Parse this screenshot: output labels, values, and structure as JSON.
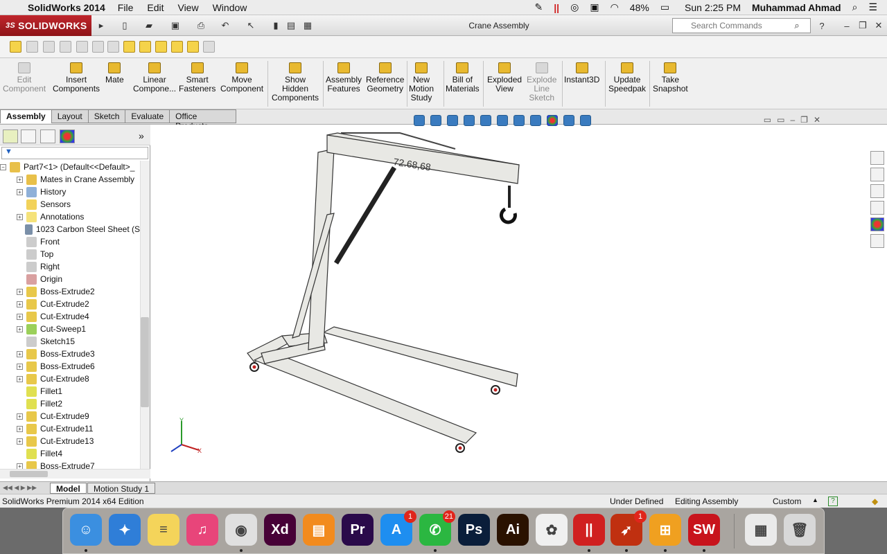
{
  "menubar": {
    "apple_icon": "apple-icon",
    "app_name": "SolidWorks 2014",
    "menus": [
      "File",
      "Edit",
      "View",
      "Window"
    ],
    "battery": "48%",
    "clock": "Sun 2:25 PM",
    "user": "Muhammad Ahmad"
  },
  "titlebar": {
    "brand": "SOLIDWORKS",
    "doc_title": "Crane Assembly",
    "search_placeholder": "Search Commands"
  },
  "commands": [
    {
      "label1": "Edit",
      "label2": "Component",
      "disabled": true
    },
    {
      "label1": "Insert",
      "label2": "Components"
    },
    {
      "label1": "Mate",
      "label2": ""
    },
    {
      "label1": "Linear",
      "label2": "Compone..."
    },
    {
      "label1": "Smart",
      "label2": "Fasteners"
    },
    {
      "label1": "Move",
      "label2": "Component"
    },
    {
      "label1": "Show",
      "label2": "Hidden",
      "label3": "Components"
    },
    {
      "label1": "Assembly",
      "label2": "Features"
    },
    {
      "label1": "Reference",
      "label2": "Geometry"
    },
    {
      "label1": "New",
      "label2": "Motion",
      "label3": "Study"
    },
    {
      "label1": "Bill of",
      "label2": "Materials"
    },
    {
      "label1": "Exploded",
      "label2": "View"
    },
    {
      "label1": "Explode",
      "label2": "Line",
      "label3": "Sketch",
      "disabled": true
    },
    {
      "label1": "Instant3D",
      "label2": ""
    },
    {
      "label1": "Update",
      "label2": "Speedpak"
    },
    {
      "label1": "Take",
      "label2": "Snapshot"
    }
  ],
  "tabs": [
    "Assembly",
    "Layout",
    "Sketch",
    "Evaluate",
    "Office Products"
  ],
  "tree": {
    "root": "Part7<1> (Default<<Default>_",
    "items": [
      {
        "label": "Mates in Crane Assembly",
        "exp": true,
        "color": "#e8c04a"
      },
      {
        "label": "History",
        "exp": true,
        "color": "#8fb0d8"
      },
      {
        "label": "Sensors",
        "exp": false,
        "color": "#f2d25a"
      },
      {
        "label": "Annotations",
        "exp": true,
        "color": "#f5e27a"
      },
      {
        "label": "1023 Carbon Steel Sheet (S",
        "exp": false,
        "color": "#7a8fa8"
      },
      {
        "label": "Front",
        "exp": false,
        "color": "#cccccc"
      },
      {
        "label": "Top",
        "exp": false,
        "color": "#cccccc"
      },
      {
        "label": "Right",
        "exp": false,
        "color": "#cccccc"
      },
      {
        "label": "Origin",
        "exp": false,
        "color": "#d9a0a0"
      },
      {
        "label": "Boss-Extrude2",
        "exp": true,
        "color": "#e8c84a"
      },
      {
        "label": "Cut-Extrude2",
        "exp": true,
        "color": "#e8c84a"
      },
      {
        "label": "Cut-Extrude4",
        "exp": true,
        "color": "#e8c84a"
      },
      {
        "label": "Cut-Sweep1",
        "exp": true,
        "color": "#9bd05a"
      },
      {
        "label": "Sketch15",
        "exp": false,
        "color": "#cccccc"
      },
      {
        "label": "Boss-Extrude3",
        "exp": true,
        "color": "#e8c84a"
      },
      {
        "label": "Boss-Extrude6",
        "exp": true,
        "color": "#e8c84a"
      },
      {
        "label": "Cut-Extrude8",
        "exp": true,
        "color": "#e8c84a"
      },
      {
        "label": "Fillet1",
        "exp": false,
        "color": "#e0e050"
      },
      {
        "label": "Fillet2",
        "exp": false,
        "color": "#e0e050"
      },
      {
        "label": "Cut-Extrude9",
        "exp": true,
        "color": "#e8c84a"
      },
      {
        "label": "Cut-Extrude11",
        "exp": true,
        "color": "#e8c84a"
      },
      {
        "label": "Cut-Extrude13",
        "exp": true,
        "color": "#e8c84a"
      },
      {
        "label": "Fillet4",
        "exp": false,
        "color": "#e0e050"
      },
      {
        "label": "Boss-Extrude7",
        "exp": true,
        "color": "#e8c84a"
      }
    ]
  },
  "viewport": {
    "dimension_label": "72.68,68",
    "axis_x": "X",
    "axis_y": "Y"
  },
  "bottom_tabs": [
    "Model",
    "Motion Study 1"
  ],
  "status": {
    "edition": "SolidWorks Premium 2014 x64 Edition",
    "state": "Under Defined",
    "mode": "Editing Assembly",
    "units": "Custom"
  },
  "dock": [
    {
      "name": "finder",
      "color": "#3b8fe0",
      "glyph": "☺"
    },
    {
      "name": "safari",
      "color": "#2f7ed8",
      "glyph": "✦"
    },
    {
      "name": "notes",
      "color": "#f4d45a",
      "glyph": "≡"
    },
    {
      "name": "itunes",
      "color": "#e8457a",
      "glyph": "♫"
    },
    {
      "name": "chrome",
      "color": "#e0e0e0",
      "glyph": "◉"
    },
    {
      "name": "adobe-xd",
      "color": "#470137",
      "glyph": "Xd"
    },
    {
      "name": "ibooks",
      "color": "#f28b1e",
      "glyph": "▤"
    },
    {
      "name": "premiere",
      "color": "#2a0a4a",
      "glyph": "Pr"
    },
    {
      "name": "app-store",
      "color": "#1e8ef0",
      "glyph": "A",
      "badge": "1"
    },
    {
      "name": "whatsapp",
      "color": "#2bb741",
      "glyph": "✆",
      "badge": "21"
    },
    {
      "name": "photoshop",
      "color": "#0a1e3a",
      "glyph": "Ps"
    },
    {
      "name": "illustrator",
      "color": "#2a1200",
      "glyph": "Ai"
    },
    {
      "name": "photos",
      "color": "#f0f0f0",
      "glyph": "✿"
    },
    {
      "name": "parallels",
      "color": "#d02020",
      "glyph": "||"
    },
    {
      "name": "rocket",
      "color": "#c03010",
      "glyph": "➶",
      "badge": "1"
    },
    {
      "name": "windows",
      "color": "#f0a020",
      "glyph": "⊞"
    },
    {
      "name": "solidworks",
      "color": "#c8141c",
      "glyph": "SW"
    },
    {
      "name": "downloads",
      "color": "#eaeaea",
      "glyph": "▦"
    },
    {
      "name": "trash",
      "color": "#d8d8d8",
      "glyph": "🗑"
    }
  ]
}
